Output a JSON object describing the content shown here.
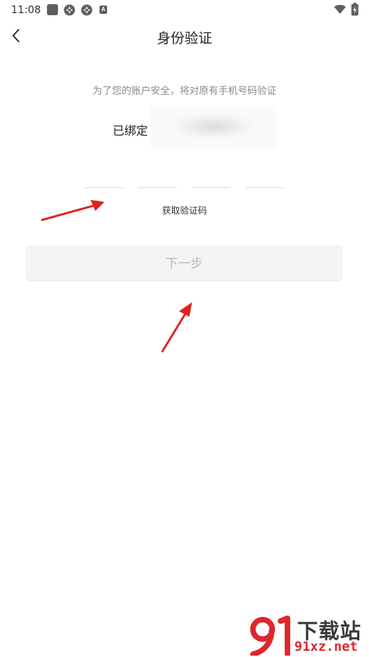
{
  "status_bar": {
    "time": "11:08",
    "icons": [
      "square-notification-icon",
      "aperture-icon",
      "aperture-icon",
      "a-letter-icon",
      "wifi-icon",
      "battery-charging-icon"
    ],
    "icon_color": "#5f5f5f"
  },
  "header": {
    "back_icon": "chevron-left-icon",
    "title": "身份验证"
  },
  "verification": {
    "hint": "为了您的账户安全，将对原有手机号码验证",
    "bound_label": "已绑定",
    "phone_number_state": "blurred",
    "code_slots": 4,
    "get_code_label": "获取验证码"
  },
  "actions": {
    "next_label": "下一步",
    "next_enabled": false
  },
  "annotations": {
    "arrow_color": "#e02020",
    "arrow_count": 2
  },
  "watermark": {
    "logo_text": "91",
    "title": "下载站",
    "domain": "91xz.net",
    "brand_color": "#e0262e"
  }
}
